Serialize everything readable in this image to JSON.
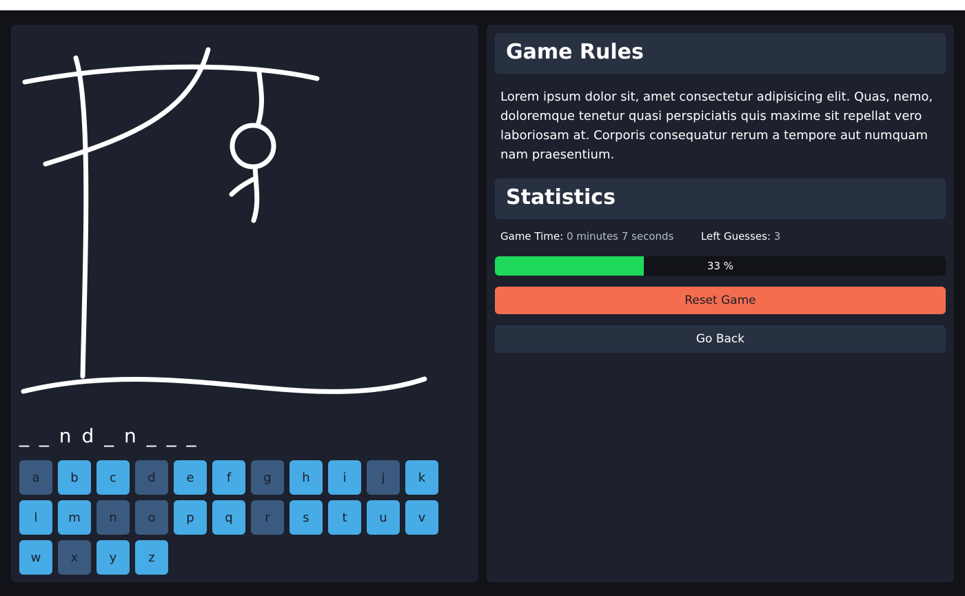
{
  "word_display": "_ _ n d _ n _ _ _",
  "keyboard": {
    "keys": [
      {
        "letter": "a",
        "used": true
      },
      {
        "letter": "b",
        "used": false
      },
      {
        "letter": "c",
        "used": false
      },
      {
        "letter": "d",
        "used": true
      },
      {
        "letter": "e",
        "used": false
      },
      {
        "letter": "f",
        "used": false
      },
      {
        "letter": "g",
        "used": true
      },
      {
        "letter": "h",
        "used": false
      },
      {
        "letter": "i",
        "used": false
      },
      {
        "letter": "j",
        "used": true
      },
      {
        "letter": "k",
        "used": false
      },
      {
        "letter": "l",
        "used": false
      },
      {
        "letter": "m",
        "used": false
      },
      {
        "letter": "n",
        "used": true
      },
      {
        "letter": "o",
        "used": true
      },
      {
        "letter": "p",
        "used": false
      },
      {
        "letter": "q",
        "used": false
      },
      {
        "letter": "r",
        "used": true
      },
      {
        "letter": "s",
        "used": false
      },
      {
        "letter": "t",
        "used": false
      },
      {
        "letter": "u",
        "used": false
      },
      {
        "letter": "v",
        "used": false
      },
      {
        "letter": "w",
        "used": false
      },
      {
        "letter": "x",
        "used": true
      },
      {
        "letter": "y",
        "used": false
      },
      {
        "letter": "z",
        "used": false
      }
    ]
  },
  "rules": {
    "title": "Game Rules",
    "text": "Lorem ipsum dolor sit, amet consectetur adipisicing elit. Quas, nemo, doloremque tenetur quasi perspiciatis quis maxime sit repellat vero laboriosam at. Corporis consequatur rerum a tempore aut numquam nam praesentium."
  },
  "statistics": {
    "title": "Statistics",
    "game_time_label": "Game Time:",
    "game_time_value": "0 minutes 7 seconds",
    "left_guesses_label": "Left Guesses:",
    "left_guesses_value": "3",
    "progress_percent": 33,
    "progress_label": "33 %"
  },
  "buttons": {
    "reset": "Reset Game",
    "back": "Go Back"
  },
  "colors": {
    "key_available": "#47abe6",
    "key_used": "#3b5a80",
    "progress_fill": "#1fd95a",
    "reset_button": "#f46d4f",
    "panel": "#1c212d"
  }
}
